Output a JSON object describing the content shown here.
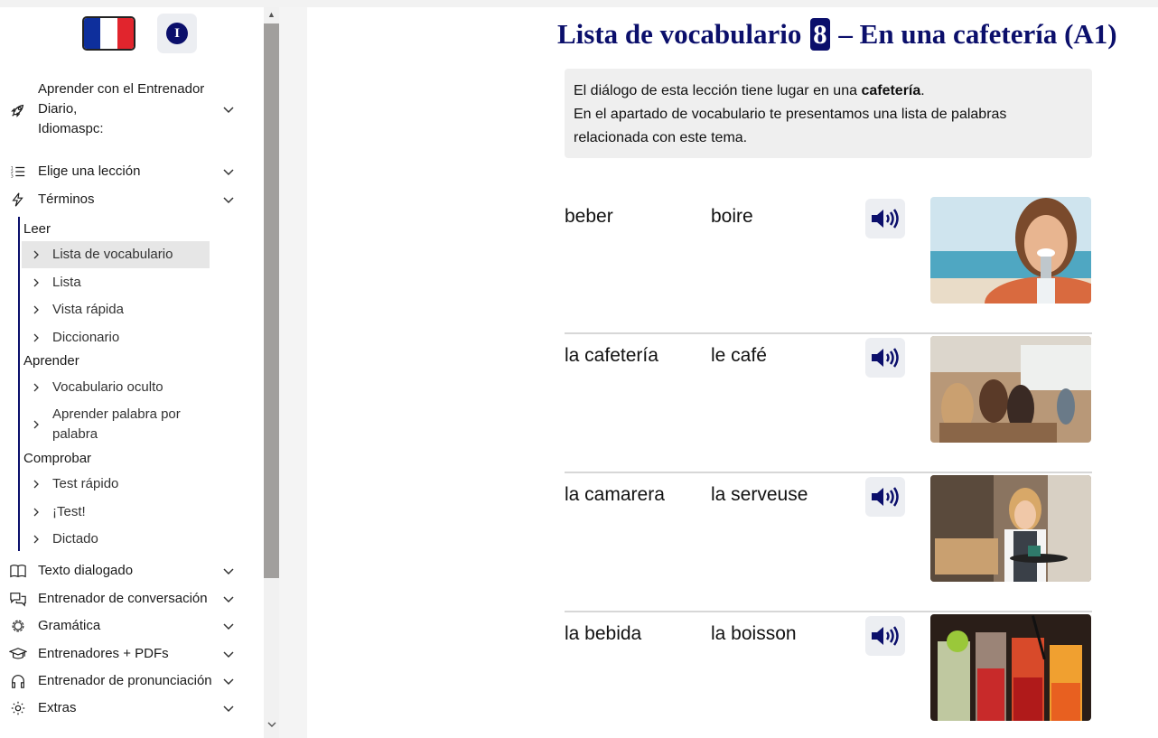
{
  "flag": {
    "colors": [
      "#0e2f9c",
      "#ffffff",
      "#e1252d"
    ]
  },
  "info_button": {
    "letter": "I"
  },
  "nav": {
    "items": [
      {
        "label_lines": [
          "Aprender con el Entrenador",
          "Diario,",
          "Idiomaspc:"
        ],
        "icon": "rocket-icon"
      },
      {
        "label": "Elige una lección",
        "icon": "list-icon"
      },
      {
        "label": "Términos",
        "icon": "lightning-icon"
      }
    ],
    "sub_groups": [
      {
        "heading": "Leer",
        "items": [
          "Lista de vocabulario",
          "Lista",
          "Vista rápida",
          "Diccionario"
        ]
      },
      {
        "heading": "Aprender",
        "items": [
          "Vocabulario oculto",
          "Aprender palabra por palabra"
        ]
      },
      {
        "heading": "Comprobar",
        "items": [
          "Test rápido",
          "¡Test!",
          "Dictado"
        ]
      }
    ],
    "bottom_items": [
      {
        "label": "Texto dialogado",
        "icon": "book-icon"
      },
      {
        "label": "Entrenador de conversación",
        "icon": "chat-icon"
      },
      {
        "label": "Gramática",
        "icon": "gear-cog-icon"
      },
      {
        "label": "Entrenadores + PDFs",
        "icon": "graduation-cap-icon"
      },
      {
        "label": "Entrenador de pronunciación",
        "icon": "headphones-icon"
      },
      {
        "label": "Extras",
        "icon": "settings-icon"
      }
    ]
  },
  "main": {
    "title_before": "Lista de vocabulario ",
    "title_number": "8",
    "title_after": " – En una cafetería (A1)",
    "intro_line1_before": "El diálogo de esta lección tiene lugar en una ",
    "intro_line1_bold": "cafetería",
    "intro_line1_after": ".",
    "intro_line2": "En el apartado de vocabulario te presentamos una lista de palabras relacionada con este tema.",
    "vocab": [
      {
        "es": "beber",
        "fr": "boire"
      },
      {
        "es": "la cafetería",
        "fr": "le café"
      },
      {
        "es": "la camarera",
        "fr": "la serveuse"
      },
      {
        "es": "la bebida",
        "fr": "la boisson"
      }
    ]
  },
  "colors": {
    "accent": "#0b0f6b"
  }
}
